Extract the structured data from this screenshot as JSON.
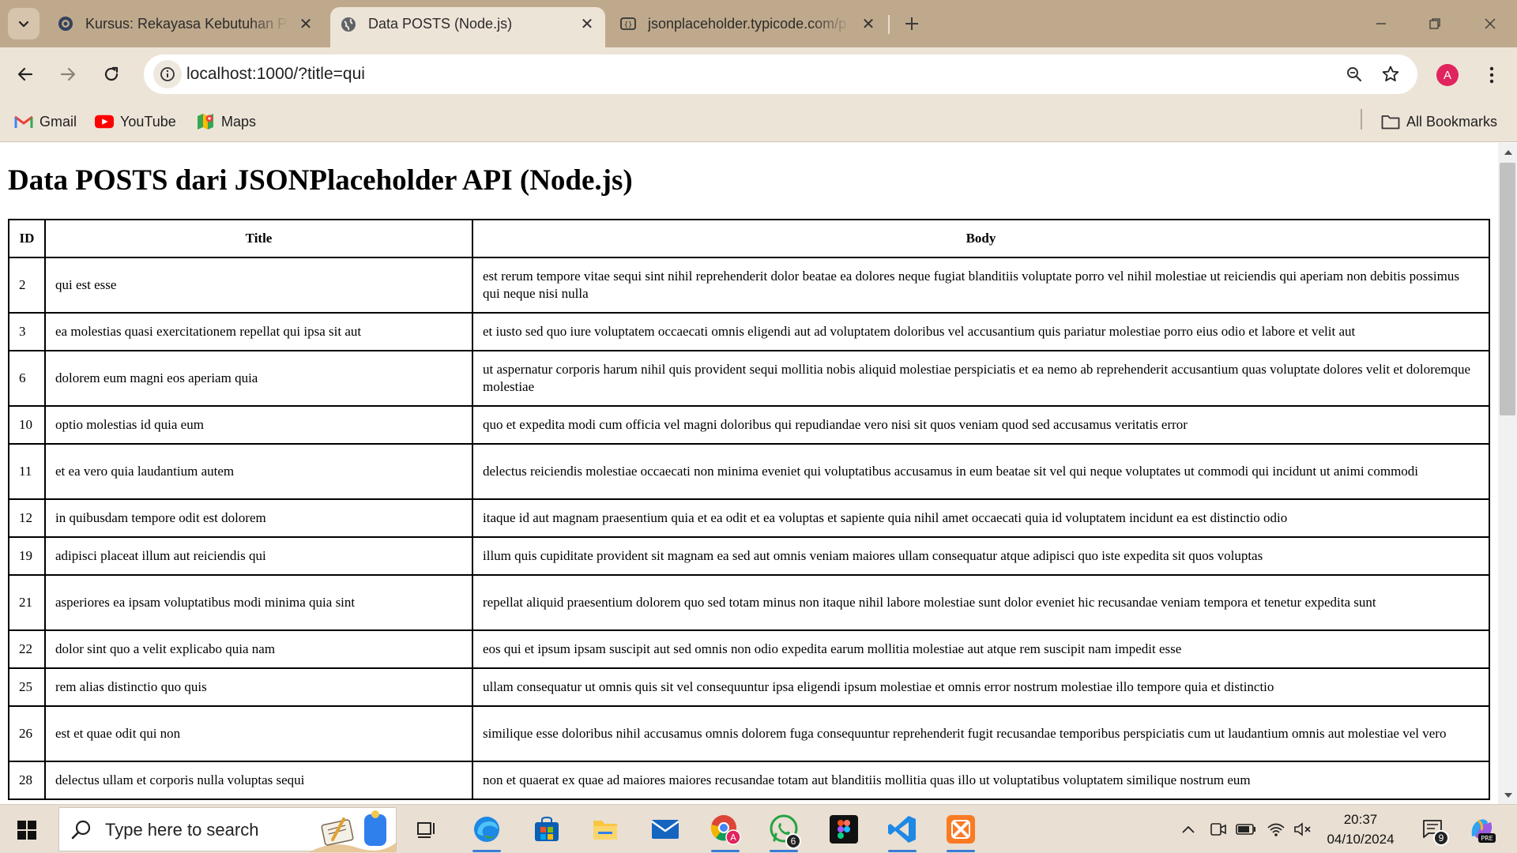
{
  "browser": {
    "tabs": [
      {
        "title": "Kursus: Rekayasa Kebutuhan Pe",
        "active": false
      },
      {
        "title": "Data POSTS (Node.js)",
        "active": true
      },
      {
        "title": "jsonplaceholder.typicode.com/p",
        "active": false
      }
    ],
    "url": "localhost:1000/?title=qui",
    "profile_initial": "A",
    "profile_color": "#e0245e",
    "bookmarks": [
      {
        "label": "Gmail",
        "icon": "gmail-icon"
      },
      {
        "label": "YouTube",
        "icon": "youtube-icon"
      },
      {
        "label": "Maps",
        "icon": "maps-icon"
      }
    ],
    "all_bookmarks": "All Bookmarks"
  },
  "page": {
    "title": "Data POSTS dari JSONPlaceholder API (Node.js)",
    "columns": [
      "ID",
      "Title",
      "Body"
    ],
    "rows": [
      {
        "id": "2",
        "title": "qui est esse",
        "body": "est rerum tempore vitae sequi sint nihil reprehenderit dolor beatae ea dolores neque fugiat blanditiis voluptate porro vel nihil molestiae ut reiciendis qui aperiam non debitis possimus qui neque nisi nulla"
      },
      {
        "id": "3",
        "title": "ea molestias quasi exercitationem repellat qui ipsa sit aut",
        "body": "et iusto sed quo iure voluptatem occaecati omnis eligendi aut ad voluptatem doloribus vel accusantium quis pariatur molestiae porro eius odio et labore et velit aut"
      },
      {
        "id": "6",
        "title": "dolorem eum magni eos aperiam quia",
        "body": "ut aspernatur corporis harum nihil quis provident sequi mollitia nobis aliquid molestiae perspiciatis et ea nemo ab reprehenderit accusantium quas voluptate dolores velit et doloremque molestiae"
      },
      {
        "id": "10",
        "title": "optio molestias id quia eum",
        "body": "quo et expedita modi cum officia vel magni doloribus qui repudiandae vero nisi sit quos veniam quod sed accusamus veritatis error"
      },
      {
        "id": "11",
        "title": "et ea vero quia laudantium autem",
        "body": "delectus reiciendis molestiae occaecati non minima eveniet qui voluptatibus accusamus in eum beatae sit vel qui neque voluptates ut commodi qui incidunt ut animi commodi"
      },
      {
        "id": "12",
        "title": "in quibusdam tempore odit est dolorem",
        "body": "itaque id aut magnam praesentium quia et ea odit et ea voluptas et sapiente quia nihil amet occaecati quia id voluptatem incidunt ea est distinctio odio"
      },
      {
        "id": "19",
        "title": "adipisci placeat illum aut reiciendis qui",
        "body": "illum quis cupiditate provident sit magnam ea sed aut omnis veniam maiores ullam consequatur atque adipisci quo iste expedita sit quos voluptas"
      },
      {
        "id": "21",
        "title": "asperiores ea ipsam voluptatibus modi minima quia sint",
        "body": "repellat aliquid praesentium dolorem quo sed totam minus non itaque nihil labore molestiae sunt dolor eveniet hic recusandae veniam tempora et tenetur expedita sunt"
      },
      {
        "id": "22",
        "title": "dolor sint quo a velit explicabo quia nam",
        "body": "eos qui et ipsum ipsam suscipit aut sed omnis non odio expedita earum mollitia molestiae aut atque rem suscipit nam impedit esse"
      },
      {
        "id": "25",
        "title": "rem alias distinctio quo quis",
        "body": "ullam consequatur ut omnis quis sit vel consequuntur ipsa eligendi ipsum molestiae et omnis error nostrum molestiae illo tempore quia et distinctio"
      },
      {
        "id": "26",
        "title": "est et quae odit qui non",
        "body": "similique esse doloribus nihil accusamus omnis dolorem fuga consequuntur reprehenderit fugit recusandae temporibus perspiciatis cum ut laudantium omnis aut molestiae vel vero"
      },
      {
        "id": "28",
        "title": "delectus ullam et corporis nulla voluptas sequi",
        "body": "non et quaerat ex quae ad maiores maiores recusandae totam aut blanditiis mollitia quas illo ut voluptatibus voluptatem similique nostrum eum"
      }
    ]
  },
  "taskbar": {
    "search_placeholder": "Type here to search",
    "apps": [
      {
        "name": "task-view-icon"
      },
      {
        "name": "edge-icon"
      },
      {
        "name": "microsoft-store-icon"
      },
      {
        "name": "file-explorer-icon"
      },
      {
        "name": "mail-icon"
      },
      {
        "name": "chrome-icon"
      },
      {
        "name": "whatsapp-icon",
        "badge": "6"
      },
      {
        "name": "figma-icon"
      },
      {
        "name": "vscode-icon"
      },
      {
        "name": "xampp-icon"
      }
    ],
    "time": "20:37",
    "date": "04/10/2024",
    "notification_count": "9"
  }
}
